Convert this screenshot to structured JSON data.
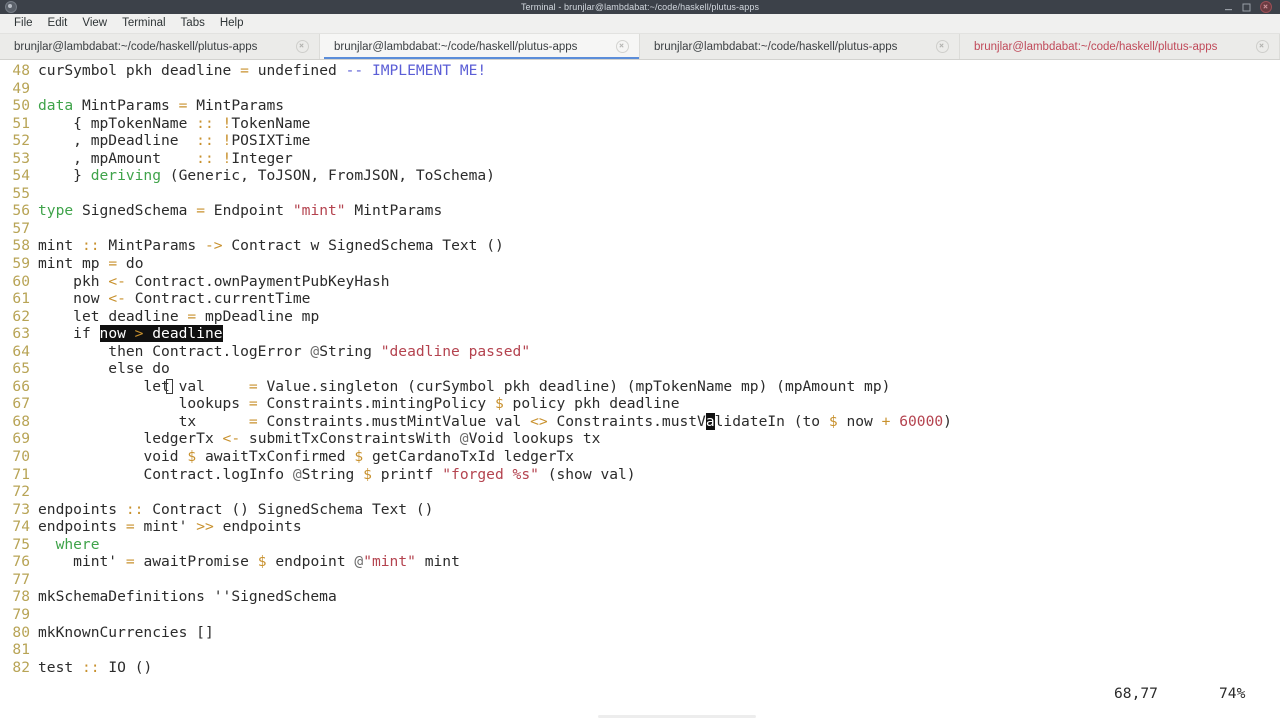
{
  "window": {
    "title": "Terminal - brunjlar@lambdabat:~/code/haskell/plutus-apps",
    "app_icon": "terminal-icon",
    "buttons": {
      "minimize": "minimize-icon",
      "maximize": "maximize-icon",
      "close": "close-icon"
    }
  },
  "menubar": {
    "items": [
      {
        "label": "File"
      },
      {
        "label": "Edit"
      },
      {
        "label": "View"
      },
      {
        "label": "Terminal"
      },
      {
        "label": "Tabs"
      },
      {
        "label": "Help"
      }
    ]
  },
  "tabs": [
    {
      "label": "brunjlar@lambdabat:~/code/haskell/plutus-apps",
      "state": "inactive"
    },
    {
      "label": "brunjlar@lambdabat:~/code/haskell/plutus-apps",
      "state": "active"
    },
    {
      "label": "brunjlar@lambdabat:~/code/haskell/plutus-apps",
      "state": "inactive"
    },
    {
      "label": "brunjlar@lambdabat:~/code/haskell/plutus-apps",
      "state": "urgent"
    }
  ],
  "editor": {
    "search_highlight": "now > deadline",
    "cursor_char": "a",
    "lines": [
      {
        "no": "48",
        "text": "curSymbol pkh deadline = undefined -- IMPLEMENT ME!"
      },
      {
        "no": "49",
        "text": ""
      },
      {
        "no": "50",
        "text": "data MintParams = MintParams"
      },
      {
        "no": "51",
        "text": "    { mpTokenName :: !TokenName"
      },
      {
        "no": "52",
        "text": "    , mpDeadline  :: !POSIXTime"
      },
      {
        "no": "53",
        "text": "    , mpAmount    :: !Integer"
      },
      {
        "no": "54",
        "text": "    } deriving (Generic, ToJSON, FromJSON, ToSchema)"
      },
      {
        "no": "55",
        "text": ""
      },
      {
        "no": "56",
        "text": "type SignedSchema = Endpoint \"mint\" MintParams"
      },
      {
        "no": "57",
        "text": ""
      },
      {
        "no": "58",
        "text": "mint :: MintParams -> Contract w SignedSchema Text ()"
      },
      {
        "no": "59",
        "text": "mint mp = do"
      },
      {
        "no": "60",
        "text": "    pkh <- Contract.ownPaymentPubKeyHash"
      },
      {
        "no": "61",
        "text": "    now <- Contract.currentTime"
      },
      {
        "no": "62",
        "text": "    let deadline = mpDeadline mp"
      },
      {
        "no": "63",
        "text": "    if now > deadline"
      },
      {
        "no": "64",
        "text": "        then Contract.logError @String \"deadline passed\""
      },
      {
        "no": "65",
        "text": "        else do"
      },
      {
        "no": "66",
        "text": "            let val     = Value.singleton (curSymbol pkh deadline) (mpTokenName mp) (mpAmount mp)"
      },
      {
        "no": "67",
        "text": "                lookups = Constraints.mintingPolicy $ policy pkh deadline"
      },
      {
        "no": "68",
        "text": "                tx      = Constraints.mustMintValue val <> Constraints.mustValidateIn (to $ now + 60000)"
      },
      {
        "no": "69",
        "text": "            ledgerTx <- submitTxConstraintsWith @Void lookups tx"
      },
      {
        "no": "70",
        "text": "            void $ awaitTxConfirmed $ getCardanoTxId ledgerTx"
      },
      {
        "no": "71",
        "text": "            Contract.logInfo @String $ printf \"forged %s\" (show val)"
      },
      {
        "no": "72",
        "text": ""
      },
      {
        "no": "73",
        "text": "endpoints :: Contract () SignedSchema Text ()"
      },
      {
        "no": "74",
        "text": "endpoints = mint' >> endpoints"
      },
      {
        "no": "75",
        "text": "  where"
      },
      {
        "no": "76",
        "text": "    mint' = awaitPromise $ endpoint @\"mint\" mint"
      },
      {
        "no": "77",
        "text": ""
      },
      {
        "no": "78",
        "text": "mkSchemaDefinitions ''SignedSchema"
      },
      {
        "no": "79",
        "text": ""
      },
      {
        "no": "80",
        "text": "mkKnownCurrencies []"
      },
      {
        "no": "81",
        "text": ""
      },
      {
        "no": "82",
        "text": "test :: IO ()"
      }
    ]
  },
  "statusline": {
    "position": "68,77",
    "percent": "74%"
  },
  "colors": {
    "titlebar_bg": "#3c4149",
    "menubar_bg": "#f0f0ef",
    "tabbar_bg": "#ebebe9",
    "active_tab_underline": "#5b8dd9",
    "urgent_tab_text": "#c04a5a",
    "terminal_bg": "#ffffff",
    "terminal_fg": "#2b2b2b",
    "line_number": "#b8a456",
    "keyword": "#3fa34a",
    "operator": "#c8912e",
    "string": "#b4434f",
    "comment": "#5b5ed6",
    "search_highlight_bg": "#101010",
    "search_highlight_fg": "#ffffff"
  }
}
